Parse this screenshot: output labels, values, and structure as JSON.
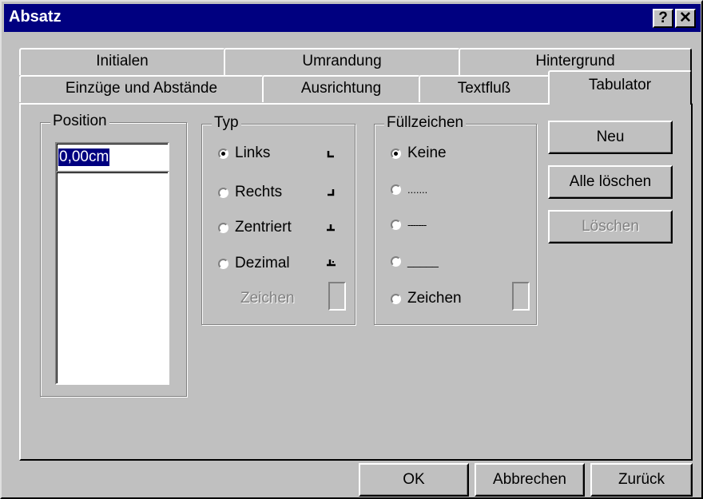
{
  "window": {
    "title": "Absatz",
    "help_button": "?",
    "close_button": "✕"
  },
  "tabs_row1": [
    "Initialen",
    "Umrandung",
    "Hintergrund"
  ],
  "tabs_row2": [
    "Einzüge und Abstände",
    "Ausrichtung",
    "Textfluß",
    "Tabulator"
  ],
  "active_tab": "Tabulator",
  "position": {
    "label": "Position",
    "value": "0,00cm"
  },
  "typ": {
    "label": "Typ",
    "options": [
      "Links",
      "Rechts",
      "Zentriert",
      "Dezimal"
    ],
    "selected": "Links",
    "glyphs": [
      "left-tab-icon",
      "right-tab-icon",
      "center-tab-icon",
      "decimal-tab-icon"
    ],
    "zeichen_label": "Zeichen"
  },
  "fuellzeichen": {
    "label": "Füllzeichen",
    "options": [
      "Keine",
      ".......",
      "-------",
      "_____",
      "Zeichen"
    ],
    "selected": "Keine"
  },
  "side_buttons": {
    "new": "Neu",
    "delete_all": "Alle löschen",
    "delete": "Löschen"
  },
  "footer": {
    "ok": "OK",
    "cancel": "Abbrechen",
    "back": "Zurück"
  }
}
